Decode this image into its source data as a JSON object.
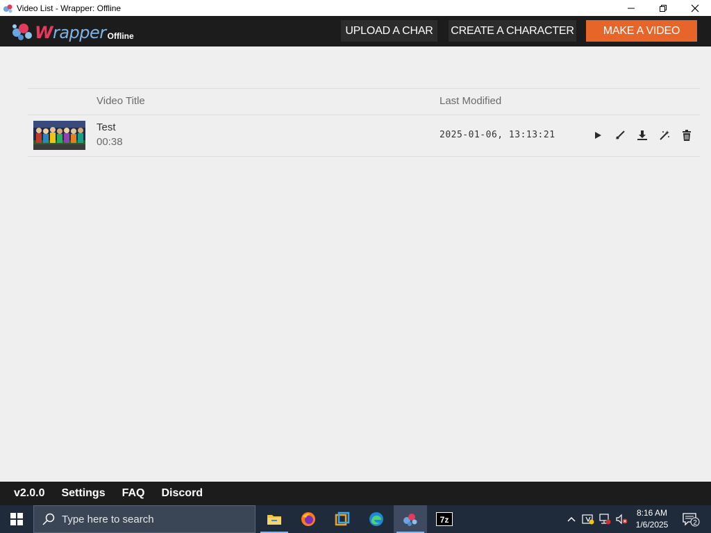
{
  "window": {
    "title": "Video List - Wrapper: Offline",
    "minimize_glyph": "—",
    "restore_glyph": "❐",
    "close_glyph": "✕"
  },
  "header": {
    "logo_text": "rapper",
    "logo_w": "W",
    "logo_sub": "Offline",
    "upload_label": "UPLOAD A CHAR",
    "create_label": "CREATE A CHARACTER",
    "make_label": "MAKE A VIDEO"
  },
  "table": {
    "columns": [
      "Video Title",
      "Last Modified"
    ],
    "rows": [
      {
        "title": "Test",
        "duration": "00:38",
        "modified": "2025-01-06, 13:13:21",
        "actions": [
          "play-icon",
          "edit-brush-icon",
          "download-icon",
          "magic-wand-icon",
          "trash-icon"
        ]
      }
    ]
  },
  "footer": {
    "version": "v2.0.0",
    "settings": "Settings",
    "faq": "FAQ",
    "discord": "Discord"
  },
  "taskbar": {
    "search_placeholder": "Type here to search",
    "time": "8:16 AM",
    "date": "1/6/2025",
    "notification_count": "2",
    "apps": [
      "file-explorer-icon",
      "firefox-icon",
      "virtual-machine-icon",
      "edge-icon",
      "wrapper-icon",
      "7zip-icon"
    ],
    "sevenzip_label": "7z"
  },
  "colors": {
    "accent": "#e8652a",
    "header_bg": "#1c1c1c",
    "page_bg": "#efefef",
    "taskbar_bg": "#1f2a3a"
  }
}
